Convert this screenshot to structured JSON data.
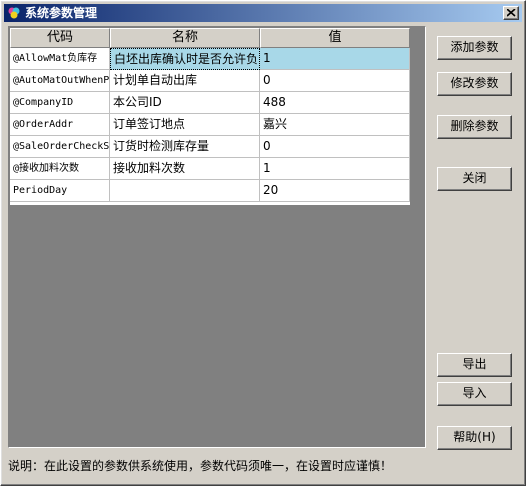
{
  "window": {
    "title": "系统参数管理"
  },
  "grid": {
    "columns": [
      "代码",
      "名称",
      "值"
    ],
    "rows": [
      {
        "code": "@AllowMat负库存",
        "name": "白坯出库确认时是否允许负",
        "value": "1",
        "selected": true
      },
      {
        "code": "@AutoMatOutWhenP",
        "name": "计划单自动出库",
        "value": "0"
      },
      {
        "code": "@CompanyID",
        "name": "本公司ID",
        "value": "488"
      },
      {
        "code": "@OrderAddr",
        "name": "订单签订地点",
        "value": "嘉兴"
      },
      {
        "code": "@SaleOrderCheckS",
        "name": "订货时检测库存量",
        "value": "0"
      },
      {
        "code": "@接收加料次数",
        "name": "接收加料次数",
        "value": "1"
      },
      {
        "code": "PeriodDay",
        "name": "",
        "value": "20"
      }
    ]
  },
  "buttons": {
    "add": "添加参数",
    "modify": "修改参数",
    "delete": "删除参数",
    "close": "关闭",
    "export": "导出",
    "import": "导入",
    "help": "帮助(H)"
  },
  "status": {
    "text": "说明：在此设置的参数供系统使用，参数代码须唯一，在设置时应谨慎！"
  },
  "colors": {
    "title_start": "#0a246a",
    "title_end": "#a6caf0",
    "selected_row": "#a8d8e8"
  }
}
